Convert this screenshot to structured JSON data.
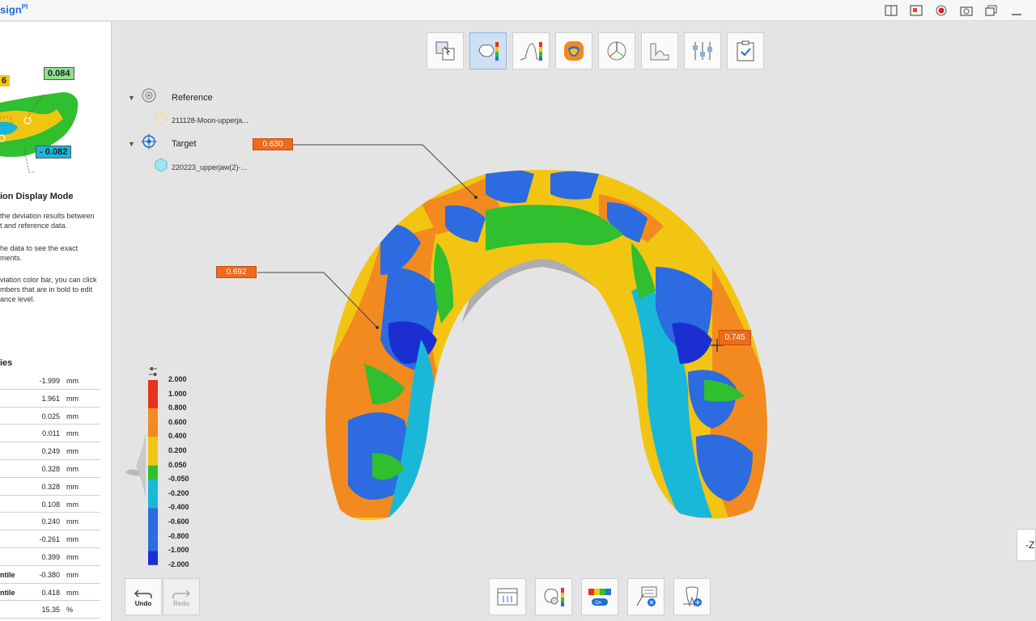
{
  "app": {
    "title": "sign",
    "title_sup": "PI"
  },
  "thumbnail": {
    "label_top": "0.084",
    "label_bottom": "- 0.082",
    "label_left": "6"
  },
  "left_panel": {
    "section_title": "ion Display Mode",
    "desc_lines": [
      " the deviation results between",
      "t and reference data.",
      "",
      "he data to see the exact",
      "ments.",
      "",
      "viation color bar, you can click",
      "mbers that are in bold to edit",
      "ance level."
    ],
    "stats_title": "ies",
    "stats": [
      {
        "label": "",
        "value": "-1.999",
        "unit": "mm"
      },
      {
        "label": "",
        "value": "1.961",
        "unit": "mm"
      },
      {
        "label": "",
        "value": "0.025",
        "unit": "mm"
      },
      {
        "label": "",
        "value": "0.011",
        "unit": "mm"
      },
      {
        "label": "",
        "value": "0.249",
        "unit": "mm"
      },
      {
        "label": "",
        "value": "0.328",
        "unit": "mm"
      },
      {
        "label": "",
        "value": "0.328",
        "unit": "mm"
      },
      {
        "label": "",
        "value": "0.108",
        "unit": "mm"
      },
      {
        "label": "",
        "value": "0.240",
        "unit": "mm"
      },
      {
        "label": "",
        "value": "-0.261",
        "unit": "mm"
      },
      {
        "label": "",
        "value": "0.399",
        "unit": "mm"
      },
      {
        "label": "ntile",
        "value": "-0.380",
        "unit": "mm"
      },
      {
        "label": "ntile",
        "value": "0.418",
        "unit": "mm"
      },
      {
        "label": "",
        "value": "15.35",
        "unit": "%"
      }
    ]
  },
  "tree": {
    "reference_label": "Reference",
    "reference_file": "211128-Moon-upperja...",
    "target_label": "Target",
    "target_file": "220223_upperjaw(2)-..."
  },
  "callouts": [
    "0.630",
    "0.692",
    "0.745"
  ],
  "color_bar": {
    "ticks": [
      "2.000",
      "1.000",
      "0.800",
      "0.600",
      "0.400",
      "0.200",
      "0.050",
      "-0.050",
      "-0.200",
      "-0.400",
      "-0.600",
      "-0.800",
      "-1.000",
      "-2.000"
    ],
    "colors": {
      "red": "#e8321e",
      "orange": "#f28a1f",
      "yellow": "#f3c513",
      "green": "#2fbf2f",
      "cyan": "#1ab8d8",
      "blue": "#2c6be0",
      "darkblue": "#1b2fd1"
    }
  },
  "bottom": {
    "undo_label": "Undo",
    "redo_label": "Redo"
  },
  "corner_text": "-Z"
}
